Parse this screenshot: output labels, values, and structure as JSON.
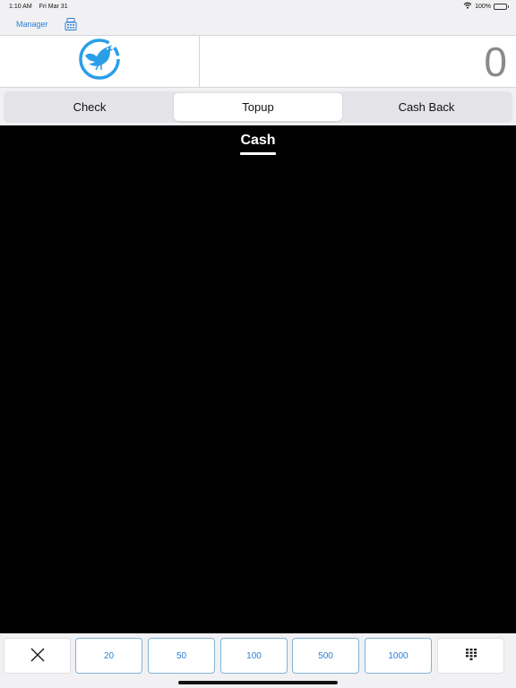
{
  "status_bar": {
    "time": "1:10 AM",
    "date": "Fri Mar 31",
    "battery": "100%",
    "wifi_icon": "wifi-icon",
    "battery_icon": "battery-icon"
  },
  "nav": {
    "manager_label": "Manager",
    "register_icon": "cash-register-icon"
  },
  "header": {
    "logo_icon": "bird-logo-icon",
    "amount": "0"
  },
  "tabs": [
    {
      "label": "Check",
      "active": false
    },
    {
      "label": "Topup",
      "active": true
    },
    {
      "label": "Cash Back",
      "active": false
    }
  ],
  "main": {
    "section_title": "Cash"
  },
  "bottom_bar": {
    "clear_icon": "close-icon",
    "amounts": [
      "20",
      "50",
      "100",
      "500",
      "1000"
    ],
    "keypad_icon": "keypad-icon"
  },
  "colors": {
    "accent": "#2a7fd8",
    "logo": "#2a9fe8",
    "content_background": "#000000"
  }
}
